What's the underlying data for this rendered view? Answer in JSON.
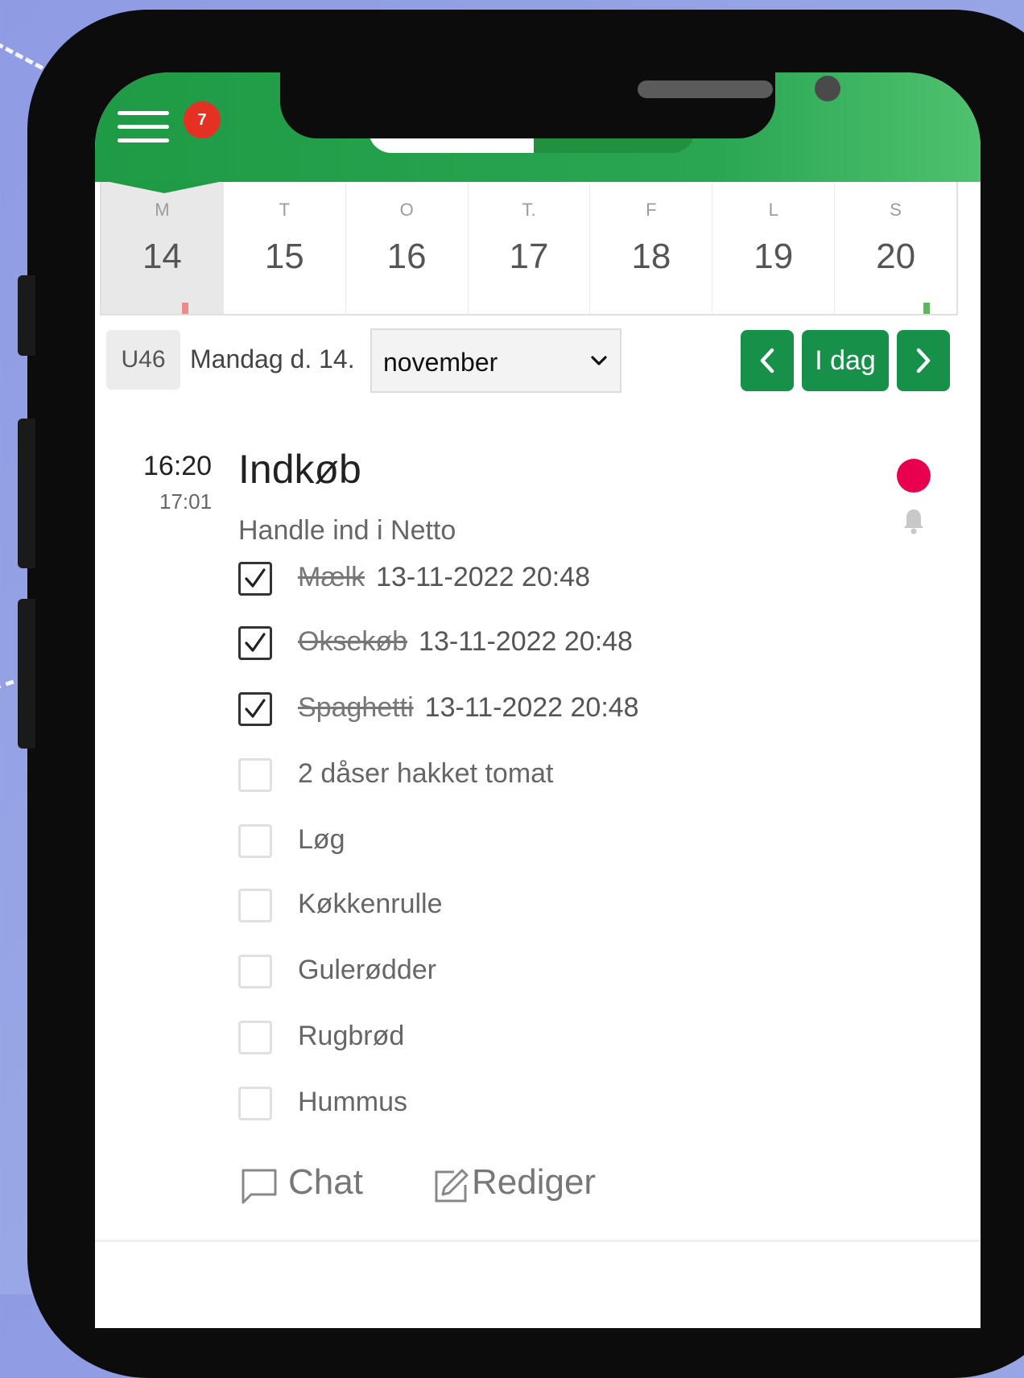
{
  "header": {
    "notification_count": "7",
    "accent_color": "#1f9a45"
  },
  "week": {
    "days": [
      {
        "letter": "M",
        "number": "14",
        "selected": true
      },
      {
        "letter": "T",
        "number": "15"
      },
      {
        "letter": "O",
        "number": "16"
      },
      {
        "letter": "T.",
        "number": "17"
      },
      {
        "letter": "F",
        "number": "18"
      },
      {
        "letter": "L",
        "number": "19"
      },
      {
        "letter": "S",
        "number": "20"
      }
    ]
  },
  "toolbar": {
    "week_label": "U46",
    "date_text": "Mandag d. 14.",
    "month_value": "november",
    "today_label": "I dag"
  },
  "event": {
    "start_time": "16:20",
    "end_time": "17:01",
    "title": "Indkøb",
    "description": "Handle ind i Netto",
    "status_color": "#e8004f",
    "items": [
      {
        "label": "Mælk",
        "checked": true,
        "stamp": "13-11-2022 20:48"
      },
      {
        "label": "Oksekøb",
        "checked": true,
        "stamp": "13-11-2022 20:48"
      },
      {
        "label": "Spaghetti",
        "checked": true,
        "stamp": "13-11-2022 20:48"
      },
      {
        "label": "2 dåser hakket tomat",
        "checked": false
      },
      {
        "label": "Løg",
        "checked": false
      },
      {
        "label": "Køkkenrulle",
        "checked": false
      },
      {
        "label": "Gulerødder",
        "checked": false
      },
      {
        "label": "Rugbrød",
        "checked": false
      },
      {
        "label": "Hummus",
        "checked": false
      }
    ]
  },
  "actions": {
    "chat_label": "Chat",
    "edit_label": "Rediger"
  }
}
